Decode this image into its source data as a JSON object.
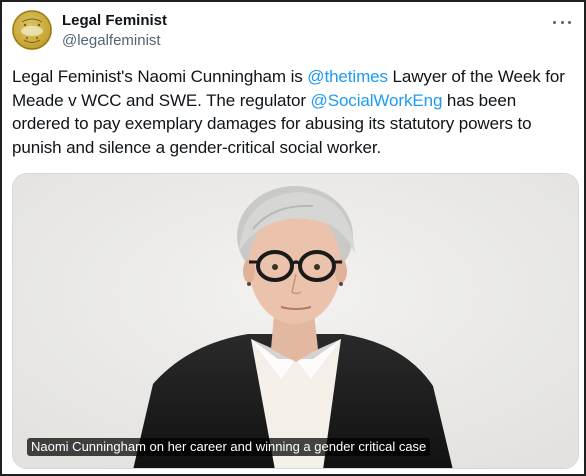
{
  "author": {
    "display_name": "Legal Feminist",
    "handle": "@legalfeminist",
    "avatar_icon": "legal-feminist-logo"
  },
  "menu": {
    "icon": "more-horizontal-icon"
  },
  "tweet": {
    "text_1": "Legal Feminist's Naomi Cunningham is ",
    "mention_1": "@thetimes",
    "text_2": "  Lawyer of the Week for Meade v WCC and SWE. The regulator ",
    "mention_2": "@SocialWorkEng",
    "text_3": " has been ordered to pay exemplary damages for abusing its statutory powers to punish and silence a gender-critical social worker."
  },
  "media": {
    "caption": "Naomi Cunningham on her career and winning a gender critical case"
  },
  "colors": {
    "link": "#1d9bf0",
    "text": "#0f1419",
    "secondary": "#536471",
    "border": "#cfd9de"
  }
}
